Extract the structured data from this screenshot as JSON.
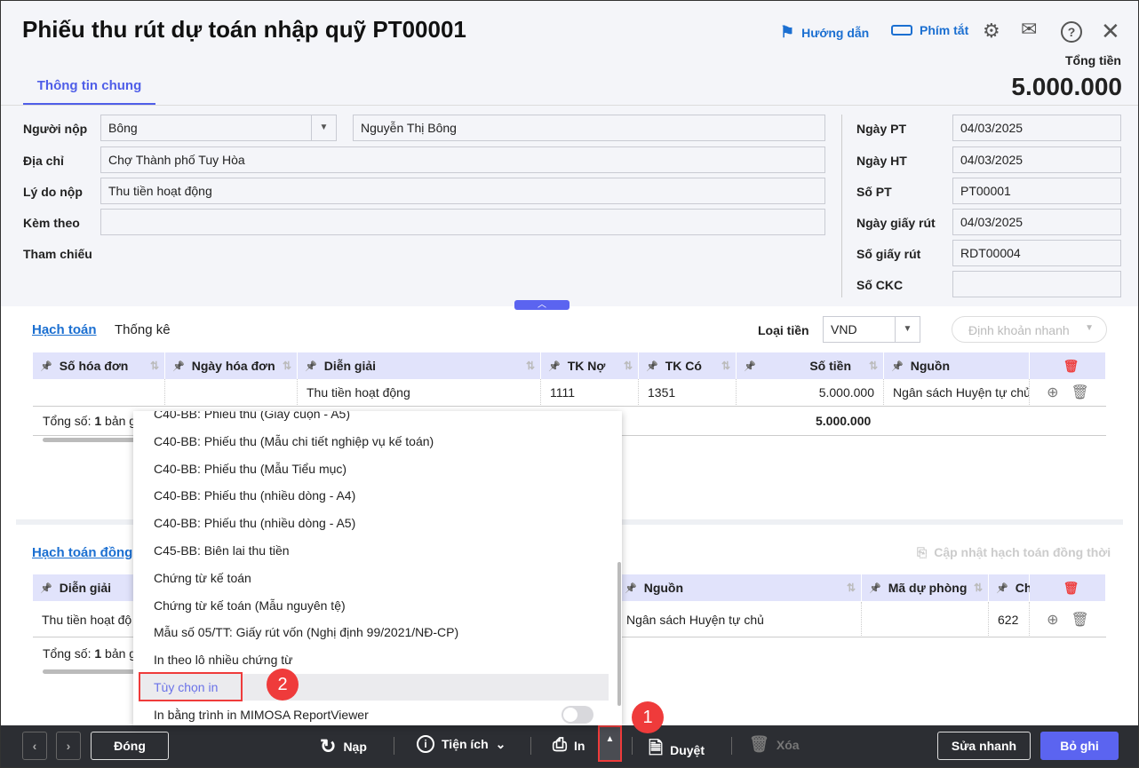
{
  "header": {
    "title": "Phiếu thu rút dự toán nhập quỹ PT00001",
    "guide": "Hướng dẫn",
    "shortcuts": "Phím tắt",
    "total_label": "Tổng tiền",
    "total_value": "5.000.000",
    "tab": "Thông tin chung"
  },
  "form": {
    "payer_label": "Người nộp",
    "payer_code": "Bông",
    "payer_name": "Nguyễn Thị Bông",
    "address_label": "Địa chỉ",
    "address": "Chợ Thành phố Tuy Hòa",
    "reason_label": "Lý do nộp",
    "reason": "Thu tiền hoạt động",
    "attach_label": "Kèm theo",
    "attach": "",
    "ref_label": "Tham chiếu",
    "right": [
      {
        "label": "Ngày PT",
        "value": "04/03/2025"
      },
      {
        "label": "Ngày HT",
        "value": "04/03/2025"
      },
      {
        "label": "Số PT",
        "value": "PT00001"
      },
      {
        "label": "Ngày giấy rút",
        "value": "04/03/2025"
      },
      {
        "label": "Số giấy rút",
        "value": "RDT00004"
      },
      {
        "label": "Số CKC",
        "value": ""
      }
    ]
  },
  "section1": {
    "tab_active": "Hạch toán",
    "tab2": "Thống kê",
    "currency_label": "Loại tiền",
    "currency": "VND",
    "quick_entry": "Định khoản nhanh",
    "columns": [
      "Số hóa đơn",
      "Ngày hóa đơn",
      "Diễn giải",
      "TK Nợ",
      "TK Có",
      "Số tiền",
      "Nguồn"
    ],
    "row": [
      "",
      "",
      "Thu tiền hoạt động",
      "1111",
      "1351",
      "5.000.000",
      "Ngân sách Huyện tự chủ"
    ],
    "total_prefix": "Tổng số: ",
    "total_count": "1",
    "total_suffix": " bản g",
    "total_amount": "5.000.000"
  },
  "section2": {
    "tab": "Hạch toán đồng",
    "update": "Cập nhật hạch toán đồng thời",
    "columns": [
      "Diễn giải",
      "Nguồn",
      "Mã dự phòng",
      "Ch"
    ],
    "row": [
      "Thu tiền hoạt độ",
      "Ngân sách Huyện tự chủ",
      "",
      "622"
    ],
    "total_prefix": "Tổng số: ",
    "total_count": "1",
    "total_suffix": " bản g"
  },
  "menu": {
    "items": [
      "C40-BB: Phiếu thu (Giấy cuộn - A5)",
      "C40-BB: Phiếu thu (Mẫu chi tiết nghiệp vụ kế toán)",
      "C40-BB: Phiếu thu (Mẫu Tiểu mục)",
      "C40-BB: Phiếu thu (nhiều dòng - A4)",
      "C40-BB: Phiếu thu (nhiều dòng - A5)",
      "C45-BB: Biên lai thu tiền",
      "Chứng từ kế toán",
      "Chứng từ kế toán (Mẫu nguyên tệ)",
      "Mẫu số 05/TT: Giấy rút vốn (Nghị định 99/2021/NĐ-CP)",
      "In theo lô nhiều chứng từ",
      "Tùy chọn in",
      "In bằng trình in MIMOSA ReportViewer"
    ],
    "toggle_on": false
  },
  "badges": [
    "1",
    "2"
  ],
  "footer": {
    "close": "Đóng",
    "reload": "Nạp",
    "utilities": "Tiện ích",
    "print": "In",
    "approve": "Duyệt",
    "delete": "Xóa",
    "quick_edit": "Sửa nhanh",
    "save": "Bỏ ghi"
  },
  "colors": {
    "accent": "#5b64f0",
    "link": "#1b6fd1",
    "highlight": "#ef3b3b",
    "bar": "#2c2e33"
  }
}
